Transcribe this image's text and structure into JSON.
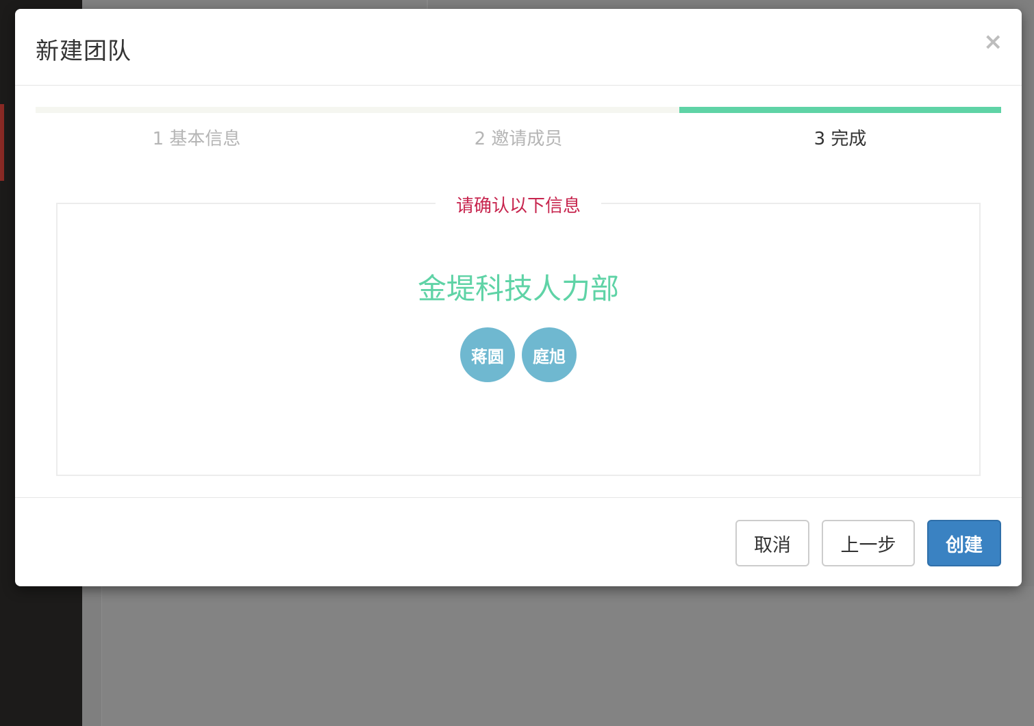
{
  "modal": {
    "title": "新建团队",
    "close_label": "×"
  },
  "steps": [
    {
      "label": "1 基本信息",
      "active": false
    },
    {
      "label": "2 邀请成员",
      "active": false
    },
    {
      "label": "3 完成",
      "active": true
    }
  ],
  "confirm": {
    "legend": "请确认以下信息",
    "team_name": "金堤科技人力部",
    "members": [
      "蒋圆",
      "庭旭"
    ]
  },
  "footer": {
    "cancel_label": "取消",
    "prev_label": "上一步",
    "create_label": "创建"
  },
  "colors": {
    "accent_green": "#5fd3a6",
    "legend_red": "#c7254e",
    "avatar_blue": "#6fb8d0",
    "primary_blue": "#3a82c2"
  }
}
